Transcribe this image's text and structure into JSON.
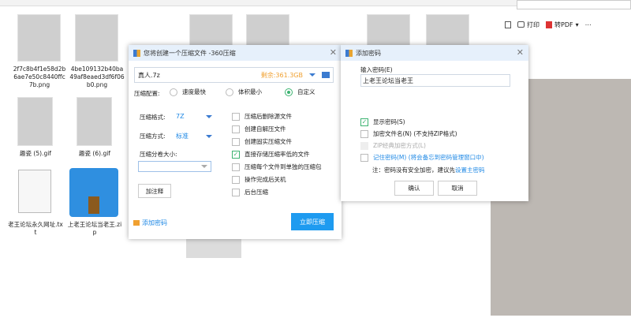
{
  "toolbar": {
    "print": "打印",
    "to_pdf": "转PDF",
    "print_icon": "printer-icon",
    "pdf_icon": "pdf-icon"
  },
  "files": [
    {
      "name": "2f7c8b4f1e58d2b6ae7e50c8440ffc7b.png"
    },
    {
      "name": "4be109132b40ba49af8eaed3df6f06b0.png"
    },
    {
      "name": "趣瓷 (5).gif"
    },
    {
      "name": "趣瓷 (6).gif"
    },
    {
      "name": "老王论坛永久网址.txt"
    },
    {
      "name": "上老王论坛当老王.zip"
    }
  ],
  "compress_dialog": {
    "title": "您将创建一个压缩文件 -360压缩",
    "filename": "真人.7z",
    "free_space": "剩余:361.3GB",
    "config_label": "压缩配置:",
    "config_options": [
      "速度最快",
      "体积最小",
      "自定义"
    ],
    "config_selected": "自定义",
    "format_label": "压缩格式:",
    "format_value": "7Z",
    "method_label": "压缩方式:",
    "method_value": "标准",
    "split_label": "压缩分卷大小:",
    "split_value": "",
    "comment_button": "加注释",
    "options": [
      {
        "label": "压缩后删除源文件",
        "checked": false
      },
      {
        "label": "创建自解压文件",
        "checked": false
      },
      {
        "label": "创建固实压缩文件",
        "checked": false
      },
      {
        "label": "直接存储压缩率低的文件",
        "checked": true
      },
      {
        "label": "压缩每个文件到单独的压缩包",
        "checked": false
      },
      {
        "label": "操作完成后关机",
        "checked": false
      },
      {
        "label": "后台压缩",
        "checked": false
      }
    ],
    "add_password": "添加密码",
    "compress_button": "立即压缩",
    "accent": "#1e9bf0"
  },
  "password_dialog": {
    "title": "添加密码",
    "input_label": "输入密码(E)",
    "password": "上老王论坛当老王",
    "options": [
      {
        "label": "显示密码(S)",
        "checked": true
      },
      {
        "label": "加密文件名(N) (不支持ZIP格式)",
        "checked": false
      },
      {
        "label": "ZIP经典加密方式(L)",
        "checked": false,
        "disabled": true
      },
      {
        "label": "记住密码(M) (将会备忘到密码管理窗口中)",
        "checked": false,
        "link": true
      }
    ],
    "note": "注：密码没有安全加密，建议先",
    "note_link": "设置主密码",
    "ok": "确认",
    "cancel": "取消"
  }
}
